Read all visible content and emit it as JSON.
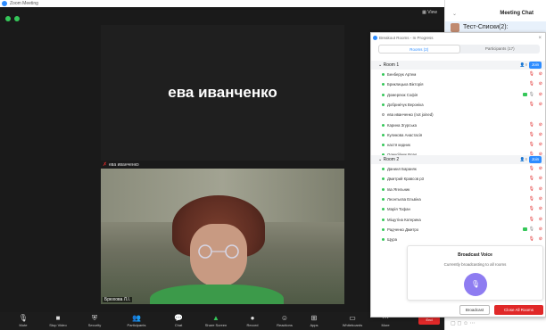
{
  "window": {
    "title": "Zoom Meeting"
  },
  "meeting": {
    "view_button": "View",
    "name_tile_text": "ева иванченко",
    "name_tile_label": "ева иванченко",
    "video_name_tag": "Брюхова Л.І."
  },
  "toolbar": {
    "items": [
      {
        "icon": "microphone-icon",
        "label": "Mute"
      },
      {
        "icon": "video-icon",
        "label": "Stop Video"
      },
      {
        "icon": "shield-icon",
        "label": "Security"
      },
      {
        "icon": "participants-icon",
        "label": "Participants",
        "count": "2"
      },
      {
        "icon": "chat-icon",
        "label": "Chat"
      },
      {
        "icon": "share-screen-icon",
        "label": "Share Screen"
      },
      {
        "icon": "record-icon",
        "label": "Record"
      },
      {
        "icon": "reactions-icon",
        "label": "Reactions"
      },
      {
        "icon": "apps-icon",
        "label": "Apps"
      },
      {
        "icon": "whiteboard-icon",
        "label": "Whiteboards"
      },
      {
        "icon": "more-icon",
        "label": "More"
      }
    ],
    "end_label": "End"
  },
  "chat": {
    "header": "Meeting Chat",
    "entries": [
      {
        "name": "Тест-Списки(2):"
      }
    ]
  },
  "breakout": {
    "title": "Breakout Rooms - In Progress",
    "tabs": [
      "Rooms (2)",
      "Participants (17)"
    ],
    "rooms": [
      {
        "name": "Room 1",
        "count": "9",
        "join_label": "Join",
        "members": [
          {
            "name": "Бенберук Артем",
            "status": "on",
            "mic": "muted"
          },
          {
            "name": "Бриклицька Вікторія",
            "status": "on",
            "mic": "muted"
          },
          {
            "name": "Домерлюк Софія",
            "status": "on",
            "mic": "on",
            "video": true
          },
          {
            "name": "Добрикічук Вероніка",
            "status": "on",
            "mic": "muted"
          },
          {
            "name": "ева иванченко   (not joined)",
            "status": "off",
            "mic": "none"
          },
          {
            "name": "Карина Згурська",
            "status": "on",
            "mic": "muted"
          },
          {
            "name": "Куликова Анастасія",
            "status": "on",
            "mic": "muted"
          },
          {
            "name": "настя кидник",
            "status": "on",
            "mic": "muted"
          },
          {
            "name": "Олексійчук Влад",
            "status": "on",
            "mic": "muted"
          }
        ]
      },
      {
        "name": "Room 2",
        "count": "8",
        "join_label": "Join",
        "members": [
          {
            "name": "Даниил Бараняк",
            "status": "on",
            "mic": "muted"
          },
          {
            "name": "Дмитрий Кравсов р3",
            "status": "on",
            "mic": "muted"
          },
          {
            "name": "Іва Ягельник",
            "status": "on",
            "mic": "muted"
          },
          {
            "name": "Леонтьєва Ельвіна",
            "status": "on",
            "mic": "muted"
          },
          {
            "name": "Марія Тофан",
            "status": "on",
            "mic": "muted"
          },
          {
            "name": "Міщутіна Катерина",
            "status": "on",
            "mic": "muted"
          },
          {
            "name": "Радченко Дмитро",
            "status": "on",
            "mic": "on",
            "video": true
          },
          {
            "name": "Щура",
            "status": "on",
            "mic": "muted"
          }
        ]
      }
    ],
    "broadcast_voice": {
      "title": "Broadcast Voice",
      "subtitle": "Currently broadcasting to all rooms"
    },
    "broadcast_button": "Broadcast",
    "close_all_button": "Close All Rooms"
  }
}
